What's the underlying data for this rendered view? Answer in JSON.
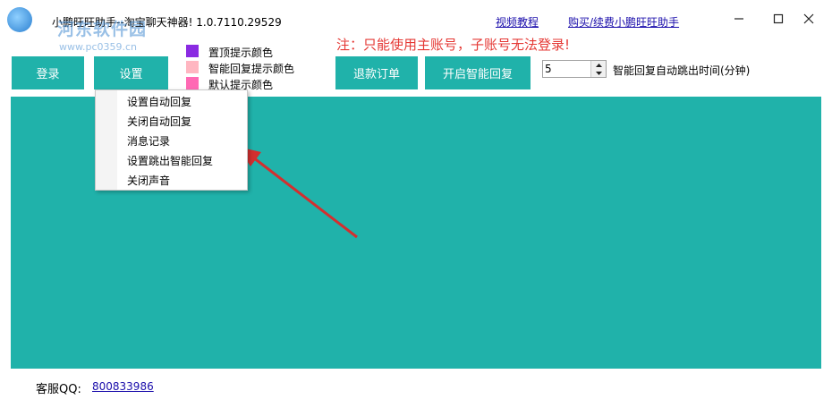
{
  "window": {
    "title": "小鹏旺旺助手--淘宝聊天神器! 1.0.7110.29529",
    "links": [
      "视频教程",
      "购买/续费小鹏旺旺助手"
    ],
    "controls": [
      "minimize-icon",
      "maximize-icon",
      "close-icon"
    ]
  },
  "watermark": {
    "name": "河东软件园",
    "url": "www.pc0359.cn"
  },
  "toolbar": {
    "login_label": "登录",
    "settings_label": "设置",
    "refund_label": "退款订单",
    "smart_reply_label": "开启智能回复"
  },
  "legend": [
    {
      "label": "置顶提示颜色",
      "color": "#8a2be2"
    },
    {
      "label": "智能回复提示颜色",
      "color": "#ffb6c1"
    },
    {
      "label": "默认提示颜色",
      "color": "#ff69b4"
    }
  ],
  "notice": "注：只能使用主账号，子账号无法登录!",
  "timeout": {
    "value": "5",
    "label": "智能回复自动跳出时间(分钟)"
  },
  "settings_menu": {
    "items": [
      "设置自动回复",
      "关闭自动回复",
      "消息记录",
      "设置跳出智能回复",
      "关闭声音"
    ]
  },
  "footer": {
    "qq_label": "客服QQ:",
    "qq_number": "800833986"
  },
  "colors": {
    "accent": "#20b2aa",
    "notice": "#e53935",
    "link": "#1a0dab",
    "arrow": "#d32f2f"
  }
}
